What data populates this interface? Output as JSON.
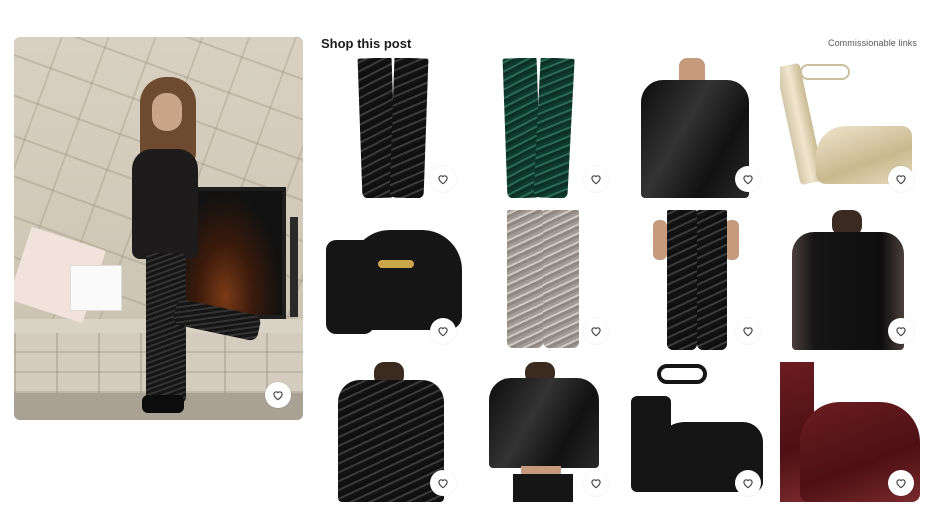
{
  "section_title": "Shop this post",
  "commission_note": "Commissionable links",
  "hero": {
    "favorite_icon": "heart-outline-icon"
  },
  "products": [
    {
      "name": "black-sequin-flare-pants",
      "favorite_icon": "heart-outline-icon"
    },
    {
      "name": "green-sequin-flare-pants",
      "favorite_icon": "heart-outline-icon"
    },
    {
      "name": "black-satin-blouse",
      "favorite_icon": "heart-outline-icon"
    },
    {
      "name": "gold-platform-sandal",
      "favorite_icon": "heart-outline-icon"
    },
    {
      "name": "black-mary-jane-platform",
      "favorite_icon": "heart-outline-icon"
    },
    {
      "name": "silver-sequin-cropped-pants",
      "favorite_icon": "heart-outline-icon"
    },
    {
      "name": "black-sequin-leggings",
      "favorite_icon": "heart-outline-icon"
    },
    {
      "name": "sheer-black-blouse",
      "favorite_icon": "heart-outline-icon"
    },
    {
      "name": "black-sequin-shirt",
      "favorite_icon": "heart-outline-icon"
    },
    {
      "name": "black-satin-shirt-set",
      "favorite_icon": "heart-outline-icon"
    },
    {
      "name": "black-ankle-strap-platform",
      "favorite_icon": "heart-outline-icon"
    },
    {
      "name": "burgundy-patent-platform",
      "favorite_icon": "heart-outline-icon"
    }
  ],
  "colors": {
    "background": "#ffffff",
    "text": "#1c1c1c",
    "muted": "#555555"
  }
}
